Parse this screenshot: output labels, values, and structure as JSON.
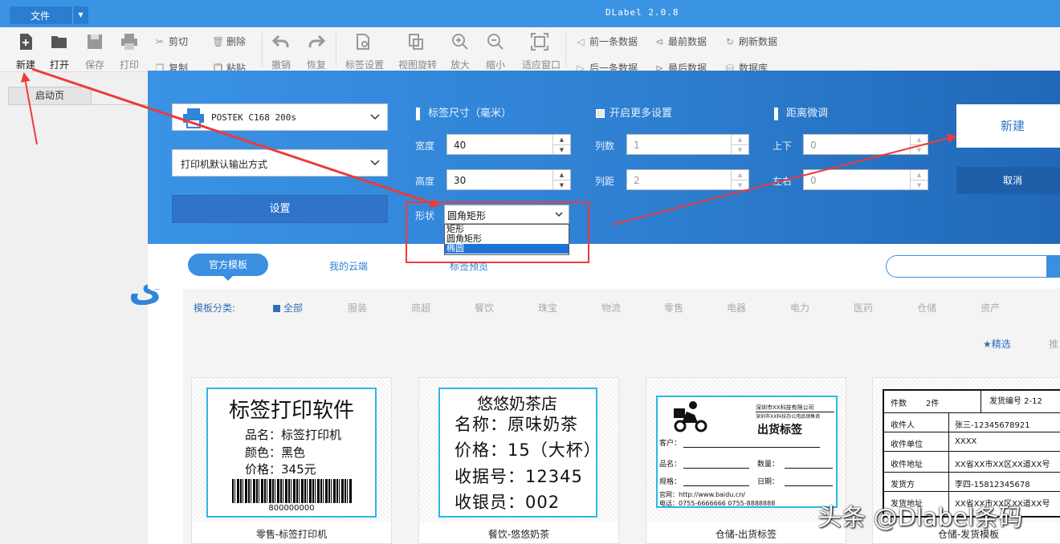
{
  "titlebar": {
    "file_menu": "文件",
    "app_title": "DLabel 2.0.8"
  },
  "toolbar": {
    "new": "新建",
    "open": "打开",
    "save": "保存",
    "print": "打印",
    "cut": "剪切",
    "delete": "删除",
    "copy": "复制",
    "paste": "粘贴",
    "undo": "撤销",
    "redo": "恢复",
    "label_settings": "标签设置",
    "view_rotate": "视图旋转",
    "zoom_in": "放大",
    "zoom_out": "缩小",
    "fit_window": "适应窗口",
    "prev_record": "前一条数据",
    "first_record": "最前数据",
    "refresh_data": "刷新数据",
    "next_record": "后一条数据",
    "last_record": "最后数据",
    "database": "数据库"
  },
  "tabs": {
    "start_page": "启动页"
  },
  "dialog": {
    "printer": "POSTEK C168 200s",
    "output_mode": "打印机默认输出方式",
    "settings_button": "设置",
    "label_size_title": "标签尺寸（毫米）",
    "width_label": "宽度",
    "width_value": "40",
    "height_label": "高度",
    "height_value": "30",
    "shape_label": "形状",
    "shape_value": "圆角矩形",
    "shape_options": [
      "矩形",
      "圆角矩形",
      "椭圆"
    ],
    "shape_selected_index": 2,
    "more_settings_title": "开启更多设置",
    "columns_label": "列数",
    "columns_value": "1",
    "col_gap_label": "列距",
    "col_gap_value": "2",
    "offset_title": "距离微调",
    "updown_label": "上下",
    "updown_value": "0",
    "leftright_label": "左右",
    "leftright_value": "0",
    "new_button": "新建",
    "cancel_button": "取消"
  },
  "templates": {
    "tab_official": "官方模板",
    "tab_cloud": "我的云端",
    "tab_preview": "标签预览",
    "category_label": "模板分类:",
    "categories": [
      "全部",
      "服装",
      "商超",
      "餐饮",
      "珠宝",
      "物流",
      "零售",
      "电器",
      "电力",
      "医药",
      "仓储",
      "资产"
    ],
    "featured": "★精选",
    "recommend": "推",
    "cards": [
      {
        "caption": "零售-标签打印机",
        "title": "标签打印软件",
        "lines": [
          "品名：标签打印机",
          "颜色：黑色",
          "价格：345元"
        ],
        "barcode_number": "800000000"
      },
      {
        "caption": "餐饮-悠悠奶茶",
        "title": "悠悠奶茶店",
        "lines": [
          "名称：原味奶茶",
          "价格：15（大杯）",
          "收据号：12345",
          "收银员：002"
        ]
      },
      {
        "caption": "仓储-出货标签",
        "company": "深圳市XX科技有限公司",
        "company2": "深圳市XX科技办公用品销售商",
        "title": "出货标签",
        "customer": "客户：",
        "name": "品名：",
        "qty": "数量：",
        "spec": "规格：",
        "date": "日期：",
        "url": "官网：http://www.baidu.cn/",
        "phone": "电话：0755-6666666  0755-8888888"
      },
      {
        "caption": "仓储-发货模板",
        "rows": [
          {
            "k": "件数",
            "v": "2件"
          },
          {
            "k": "收件人",
            "v": "张三-12345678921"
          },
          {
            "k": "收件单位",
            "v": "XXXX"
          },
          {
            "k": "收件地址",
            "v": "XX省XX市XX区XX道XX号"
          },
          {
            "k": "发货方",
            "v": "李四-15812345678"
          },
          {
            "k": "发货地址",
            "v": "XX省XX市XX区XX道XX号"
          }
        ],
        "ship_no": "发货编号  2-12"
      }
    ]
  },
  "watermark": "头条 @Dlabel条码"
}
